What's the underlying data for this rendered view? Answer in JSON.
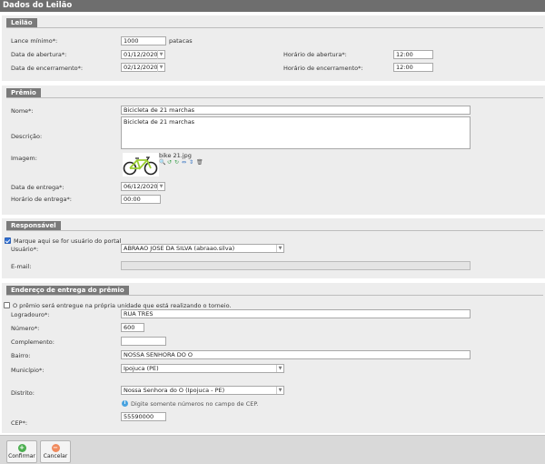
{
  "page": {
    "title": "Dados do Leilão"
  },
  "leilao": {
    "title": "Leilão",
    "lance_label": "Lance mínimo*:",
    "lance_value": "1000",
    "lance_unit": "patacas",
    "data_abertura_label": "Data de abertura*:",
    "data_abertura_value": "01/12/2020",
    "data_encerramento_label": "Data de encerramento*:",
    "data_encerramento_value": "02/12/2020",
    "horario_abertura_label": "Horário de abertura*:",
    "horario_abertura_value": "12:00",
    "horario_encerramento_label": "Horário de encerramento*:",
    "horario_encerramento_value": "12:00"
  },
  "premio": {
    "title": "Prêmio",
    "nome_label": "Nome*:",
    "nome_value": "Bicicleta de 21 marchas",
    "descricao_label": "Descrição:",
    "descricao_value": "Bicicleta de 21 marchas",
    "imagem_label": "Imagem:",
    "imagem_filename": "bike 21.jpg",
    "data_entrega_label": "Data de entrega*:",
    "data_entrega_value": "06/12/2020",
    "horario_entrega_label": "Horário de entrega*:",
    "horario_entrega_value": "00:00"
  },
  "responsavel": {
    "title": "Responsável",
    "checkbox_label": "Marque aqui se for usuário do portal",
    "checkbox_checked": true,
    "usuario_label": "Usuário*:",
    "usuario_value": "ABRAAO JOSE DA SILVA (abraao.silva)",
    "email_label": "E-mail:",
    "email_value": ""
  },
  "endereco": {
    "title": "Endereço de entrega do prêmio",
    "checkbox_label": "O prêmio será entregue na própria unidade que está realizando o torneio.",
    "checkbox_checked": false,
    "logradouro_label": "Logradouro*:",
    "logradouro_value": "RUA TRES",
    "numero_label": "Número*:",
    "numero_value": "600",
    "complemento_label": "Complemento:",
    "complemento_value": "",
    "bairro_label": "Bairro:",
    "bairro_value": "NOSSA SENHORA DO O",
    "municipio_label": "Município*:",
    "municipio_value": "Ipojuca (PE)",
    "distrito_label": "Distrito:",
    "distrito_value": "Nossa Senhora do O (Ipojuca - PE)",
    "cep_hint": "Digite somente números no campo de CEP.",
    "cep_label": "CEP*:",
    "cep_value": "55590000"
  },
  "footer": {
    "confirm_label": "Confirmar",
    "cancel_label": "Cancelar"
  },
  "colors": {
    "header_bg": "#6e6e6e",
    "section_bg": "#ededed",
    "section_title_bg": "#7a7a7a",
    "confirm_icon": "#4caf50",
    "cancel_icon": "#f08a5d"
  },
  "icons": [
    "zoom-in-icon",
    "rotate-left-icon",
    "rotate-right-icon",
    "flip-icon",
    "delete-icon",
    "info-icon",
    "confirm-icon",
    "cancel-icon"
  ]
}
